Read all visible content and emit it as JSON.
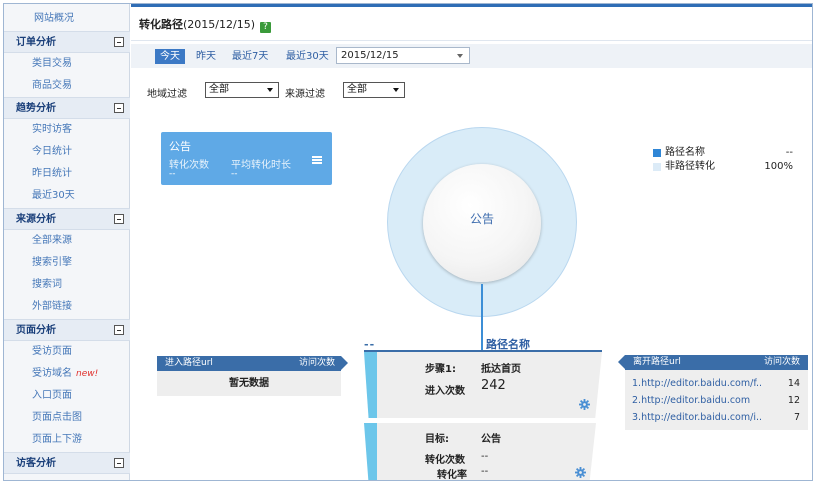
{
  "sidebar": {
    "top_item": "网站概况",
    "sections": [
      {
        "title": "订单分析",
        "items": [
          "类目交易",
          "商品交易"
        ]
      },
      {
        "title": "趋势分析",
        "items": [
          "实时访客",
          "今日统计",
          "昨日统计",
          "最近30天"
        ]
      },
      {
        "title": "来源分析",
        "items": [
          "全部来源",
          "搜索引擎",
          "搜索词",
          "外部链接"
        ]
      },
      {
        "title": "页面分析",
        "items": [
          "受访页面",
          "受访域名",
          "入口页面",
          "页面点击图",
          "页面上下游"
        ]
      },
      {
        "title": "访客分析",
        "items": []
      }
    ],
    "new_badge": "new!"
  },
  "header": {
    "title": "转化路径",
    "date": "(2015/12/15)",
    "help": "?"
  },
  "date_bar": {
    "buttons": [
      "今天",
      "昨天",
      "最近7天",
      "最近30天"
    ],
    "active": "今天",
    "selected_date": "2015/12/15"
  },
  "filters": {
    "region_label": "地域过滤",
    "region_value": "全部",
    "source_label": "来源过滤",
    "source_value": "全部"
  },
  "info_card": {
    "title": "公告",
    "metric1_label": "转化次数",
    "metric1_value": "--",
    "metric2_label": "平均转化时长",
    "metric2_value": "--"
  },
  "legend": [
    {
      "label": "路径名称",
      "value": "--",
      "color": "#2f86d6"
    },
    {
      "label": "非路径转化",
      "value": "100%",
      "color": "#dcebf7"
    }
  ],
  "donut": {
    "center_label": "公告",
    "fill_color": "#d9ecf8"
  },
  "entry_panel": {
    "header_left": "进入路径url",
    "header_right": "访问次数",
    "body": "暂无数据"
  },
  "exit_panel": {
    "header_left": "离开路径url",
    "header_right": "访问次数",
    "rows": [
      {
        "url": "1.http://editor.baidu.com/f..",
        "count": "14"
      },
      {
        "url": "2.http://editor.baidu.com",
        "count": "12"
      },
      {
        "url": "3.http://editor.baidu.com/i..",
        "count": "7"
      }
    ]
  },
  "steps": {
    "dash": "--",
    "path_name": "路径名称",
    "step1": {
      "label": "步骤1:",
      "name": "抵达首页",
      "entry_label": "进入次数",
      "entry_value": "242"
    },
    "goal": {
      "label": "目标:",
      "name": "公告",
      "conv_count_label": "转化次数",
      "conv_count_value": "--",
      "conv_rate_label": "转化率",
      "conv_rate_value": "--"
    }
  }
}
